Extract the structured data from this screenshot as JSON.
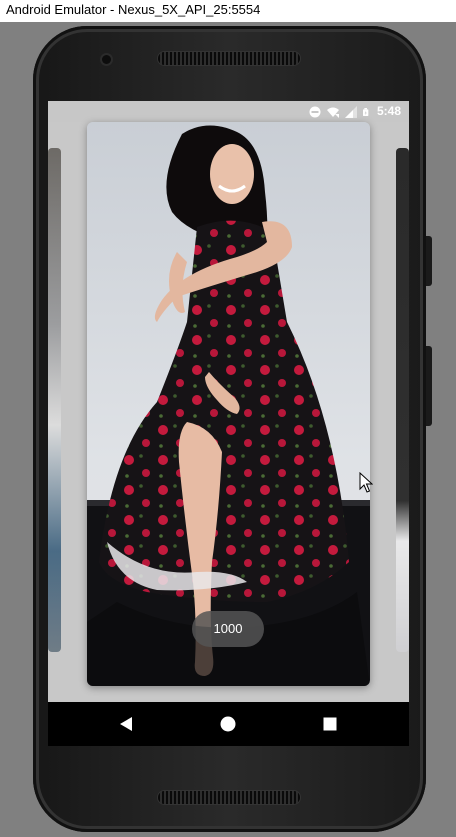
{
  "window": {
    "title": "Android Emulator - Nexus_5X_API_25:5554"
  },
  "status_bar": {
    "time": "5:48",
    "icons": [
      "do-not-disturb-icon",
      "wifi-icon",
      "signal-icon",
      "battery-icon"
    ]
  },
  "viewer": {
    "current_card": {
      "image": "photo of woman in black floral dress"
    },
    "counter_toast": "1000"
  },
  "nav_bar": {
    "buttons": [
      "back",
      "home",
      "recents"
    ]
  },
  "colors": {
    "screen_bg": "#c8c8c8",
    "nav_bg": "#000000",
    "toast_bg": "#555555"
  }
}
